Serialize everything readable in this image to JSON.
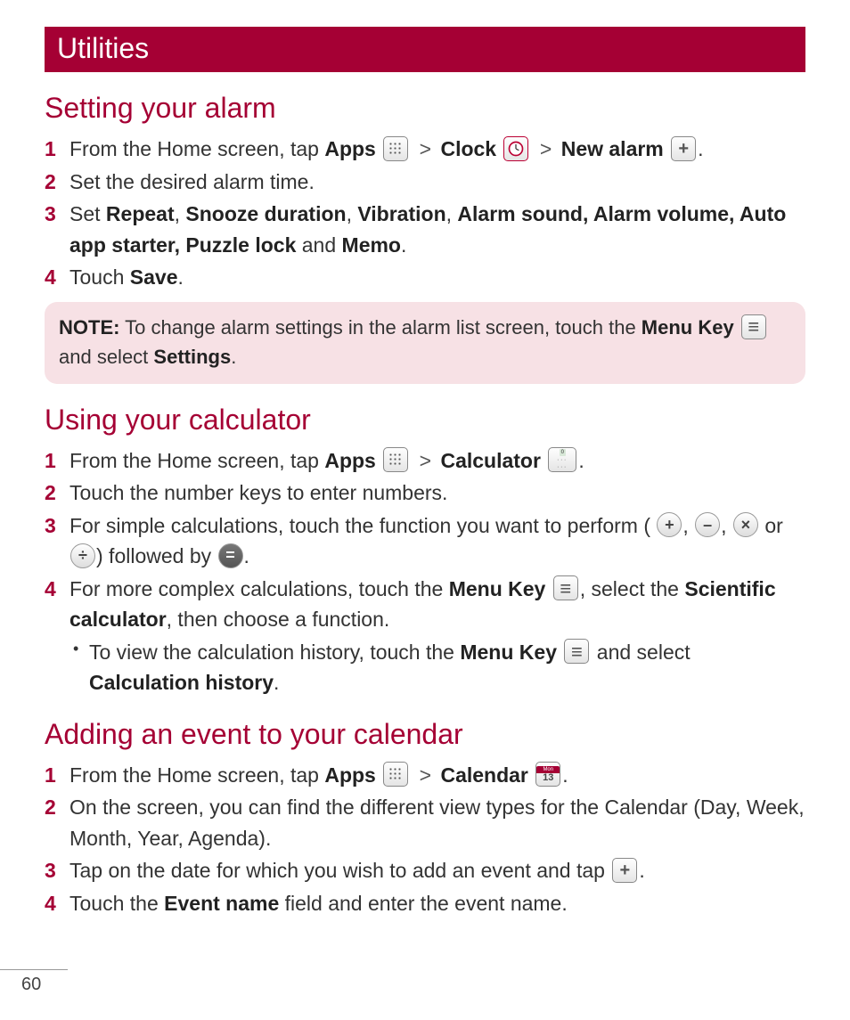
{
  "header": {
    "title": "Utilities"
  },
  "section1": {
    "heading": "Setting your alarm",
    "steps": {
      "s1": {
        "num": "1",
        "t1": "From the Home screen, tap ",
        "apps": "Apps",
        "clock": "Clock",
        "newalarm": "New alarm"
      },
      "s2": {
        "num": "2",
        "text": "Set the desired alarm time."
      },
      "s3": {
        "num": "3",
        "t1": "Set ",
        "b1": "Repeat",
        "b2": "Snooze duration",
        "b3": "Vibration",
        "b4": "Alarm sound, Alarm volume, Auto app starter, Puzzle lock",
        "t5": " and ",
        "b5": "Memo",
        "t6": "."
      },
      "s4": {
        "num": "4",
        "t1": "Touch ",
        "b1": "Save",
        "t2": "."
      }
    },
    "note": {
      "b1": "NOTE:",
      "t1": " To change alarm settings in the alarm list screen, touch the ",
      "b2": "Menu Key",
      "t2": " and select ",
      "b3": "Settings",
      "t3": "."
    }
  },
  "section2": {
    "heading": "Using your calculator",
    "steps": {
      "s1": {
        "num": "1",
        "t1": "From the Home screen, tap ",
        "apps": "Apps",
        "calc": "Calculator"
      },
      "s2": {
        "num": "2",
        "text": "Touch the number keys to enter numbers."
      },
      "s3": {
        "num": "3",
        "t1": "For simple calculations, touch the function you want to perform (",
        "t2": ") followed by ",
        "or": " or "
      },
      "s4": {
        "num": "4",
        "t1": "For more complex calculations, touch the ",
        "b1": "Menu Key",
        "t2": ", select the ",
        "b2": "Scientific calculator",
        "t3": ", then choose a function."
      }
    },
    "sub": {
      "t1": "To view the calculation history, touch the ",
      "b1": "Menu Key",
      "t2": " and select ",
      "b2": "Calculation history",
      "t3": "."
    }
  },
  "section3": {
    "heading": "Adding an event to your calendar",
    "steps": {
      "s1": {
        "num": "1",
        "t1": "From the Home screen, tap ",
        "apps": "Apps",
        "cal": "Calendar"
      },
      "s2": {
        "num": "2",
        "text": "On the screen, you can find the different view types for the Calendar (Day, Week, Month, Year, Agenda)."
      },
      "s3": {
        "num": "3",
        "text": "Tap on the date for which you wish to add an event and tap "
      },
      "s4": {
        "num": "4",
        "t1": "Touch the ",
        "b1": "Event name",
        "t2": " field and enter the event name."
      }
    }
  },
  "calendar_icon": {
    "mon": "Mon",
    "day": "13"
  },
  "gt": ">",
  "page_number": "60"
}
